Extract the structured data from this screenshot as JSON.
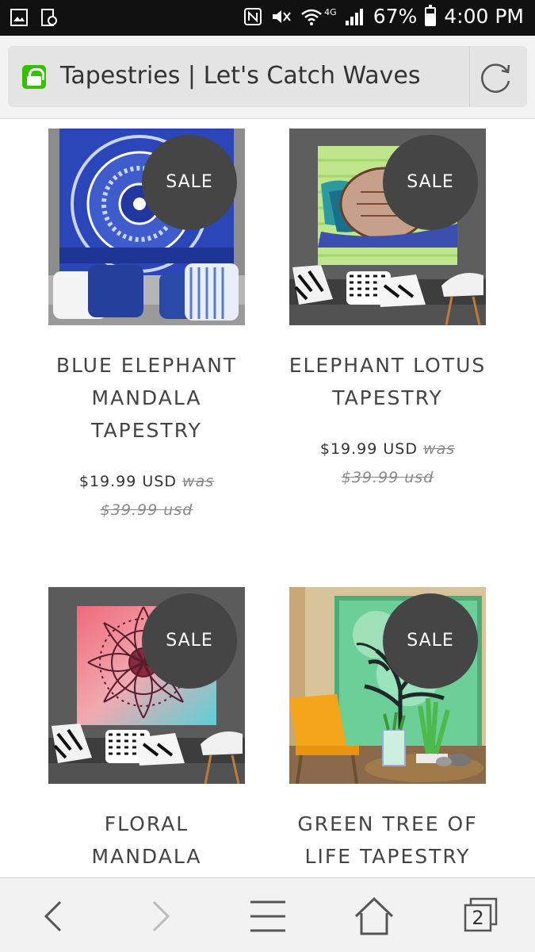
{
  "status_bar": {
    "battery": "67%",
    "battery_level": 0.67,
    "time": "4:00 PM",
    "network": "4G",
    "icons": [
      "gallery-icon",
      "screenshot-icon",
      "nfc-icon",
      "mute-icon",
      "wifi-icon",
      "signal-icon",
      "battery-icon"
    ]
  },
  "address_bar": {
    "title": "Tapestries | Let's Catch Waves",
    "lock_color": "#35c000"
  },
  "products": [
    {
      "badge": "SALE",
      "title": "BLUE ELEPHANT MANDALA TAPESTRY",
      "price": "$19.99 USD",
      "was": "was $39.99 usd"
    },
    {
      "badge": "SALE",
      "title": "ELEPHANT LOTUS TAPESTRY",
      "price": "$19.99 USD",
      "was": "was $39.99 usd"
    },
    {
      "badge": "SALE",
      "title": "FLORAL MANDALA",
      "price": "",
      "was": ""
    },
    {
      "badge": "SALE",
      "title": "GREEN TREE OF LIFE TAPESTRY",
      "price": "",
      "was": ""
    }
  ],
  "bottom_nav": {
    "tabs_count": "2",
    "icons": [
      "back-icon",
      "forward-icon",
      "menu-icon",
      "home-icon",
      "tabs-icon"
    ]
  },
  "colors": {
    "badge": "#454545",
    "status_bar": "#111111",
    "text": "#444444"
  }
}
